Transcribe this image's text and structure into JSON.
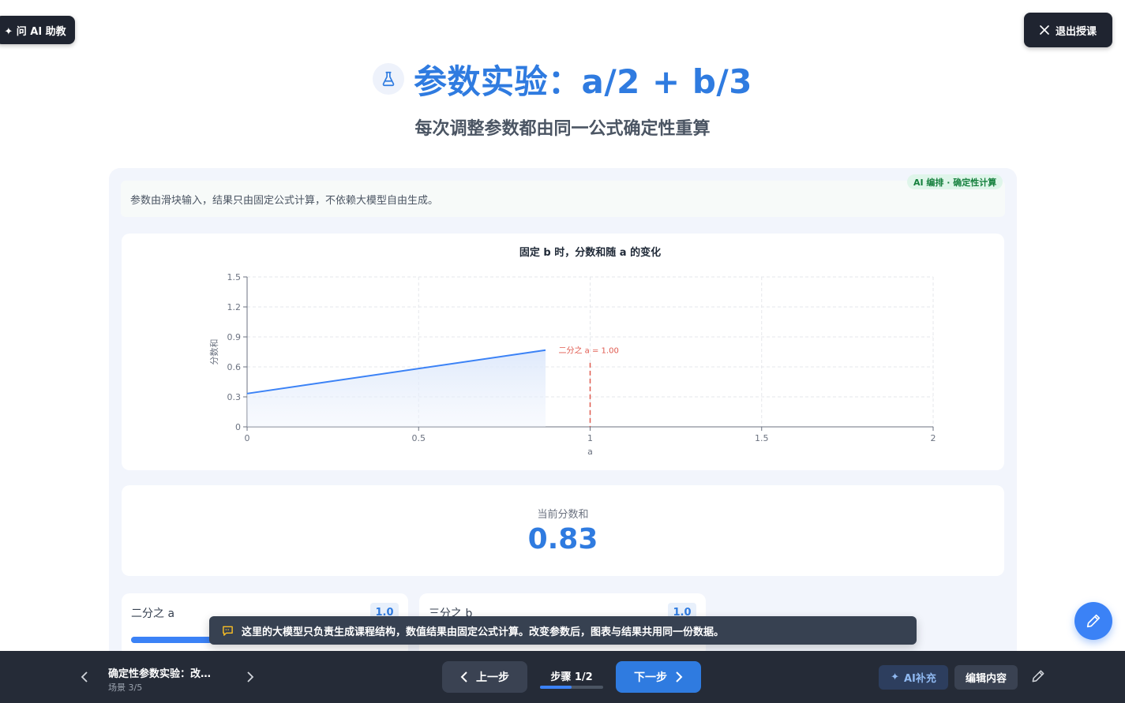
{
  "ask_ai": {
    "icon": "sparkle-icon",
    "label": "✦ 问 AI 助教"
  },
  "exit": {
    "icon": "close-icon",
    "label": "退出授课"
  },
  "header": {
    "icon": "flask-icon",
    "title": "参数实验：a/2 + b/3",
    "subtitle": "每次调整参数都由同一公式确定性重算"
  },
  "badge": "AI 编排 · 确定性计算",
  "note": "参数由滑块输入，结果只由固定公式计算，不依赖大模型自由生成。",
  "chart_data": {
    "type": "area",
    "title": "固定 b 时，分数和随 a 的变化",
    "xlabel": "a",
    "ylabel": "分数和",
    "xlim": [
      0,
      2
    ],
    "ylim": [
      0,
      1.5
    ],
    "x_ticks": [
      "0",
      "0.5",
      "1",
      "1.5",
      "2"
    ],
    "y_ticks": [
      "0",
      "0.3",
      "0.6",
      "0.9",
      "1.2",
      "1.5"
    ],
    "series": [
      {
        "x": [
          0,
          0.87
        ],
        "y": [
          0.333,
          0.768
        ]
      }
    ],
    "marker": {
      "x": 1,
      "label": "二分之 a = 1.00"
    },
    "grid": true,
    "colors": {
      "line": "#3b82f6",
      "marker": "#e05a4f"
    }
  },
  "result": {
    "label": "当前分数和",
    "value": "0.83"
  },
  "sliders": [
    {
      "label": "二分之 a",
      "value": "1.0",
      "fraction": 0.5
    },
    {
      "label": "三分之 b",
      "value": "1.0",
      "fraction": 0.5
    }
  ],
  "toast": {
    "icon": "message-icon",
    "text": "这里的大模型只负责生成课程结构，数值结果由固定公式计算。改变参数后，图表与结果共用同一份数据。"
  },
  "bottom": {
    "scene_title": "确定性参数实验：改…",
    "scene_sub": "场景 3/5",
    "prev": "上一步",
    "step": "步骤 1/2",
    "step_fraction": 0.5,
    "next": "下一步",
    "ai_supp": "AI补充",
    "edit_content": "编辑内容"
  }
}
